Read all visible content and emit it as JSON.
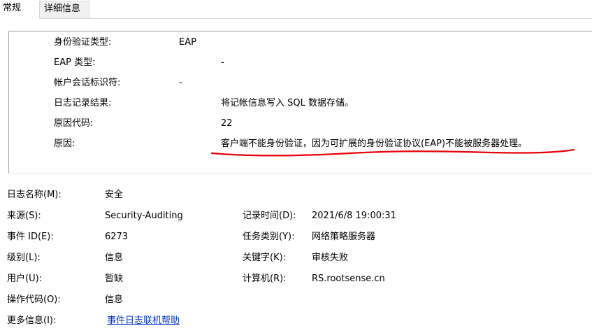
{
  "tabs": [
    {
      "label": "常规",
      "active": true
    },
    {
      "label": "详细信息",
      "active": false
    }
  ],
  "description": {
    "rows": [
      {
        "label": "身份验证类型:",
        "value": "EAP"
      },
      {
        "label": "EAP 类型:",
        "value": "-"
      },
      {
        "label": "帐户会话标识符:",
        "value": "-"
      },
      {
        "label": "日志记录结果:",
        "value": "将记帐信息写入 SQL 数据存储。"
      },
      {
        "label": "原因代码:",
        "value": "22"
      },
      {
        "label": "原因:",
        "value": "客户端不能身份验证，因为可扩展的身份验证协议(EAP)不能被服务器处理。"
      }
    ],
    "annotation_color": "#e8000b"
  },
  "properties": {
    "log_name_label": "日志名称(M):",
    "log_name_value": "安全",
    "source_label": "来源(S):",
    "source_value": "Security-Auditing",
    "logged_label": "记录时间(D):",
    "logged_value": "2021/6/8 19:00:31",
    "event_id_label": "事件 ID(E):",
    "event_id_value": "6273",
    "task_category_label": "任务类别(Y):",
    "task_category_value": "网络策略服务器",
    "level_label": "级别(L):",
    "level_value": "信息",
    "keywords_label": "关键字(K):",
    "keywords_value": "审核失败",
    "user_label": "用户(U):",
    "user_value": "暂缺",
    "computer_label": "计算机(R):",
    "computer_value": "RS.rootsense.cn",
    "opcode_label": "操作代码(O):",
    "opcode_value": "信息",
    "more_info_label": "更多信息(I):",
    "more_info_link": "事件日志联机帮助"
  }
}
